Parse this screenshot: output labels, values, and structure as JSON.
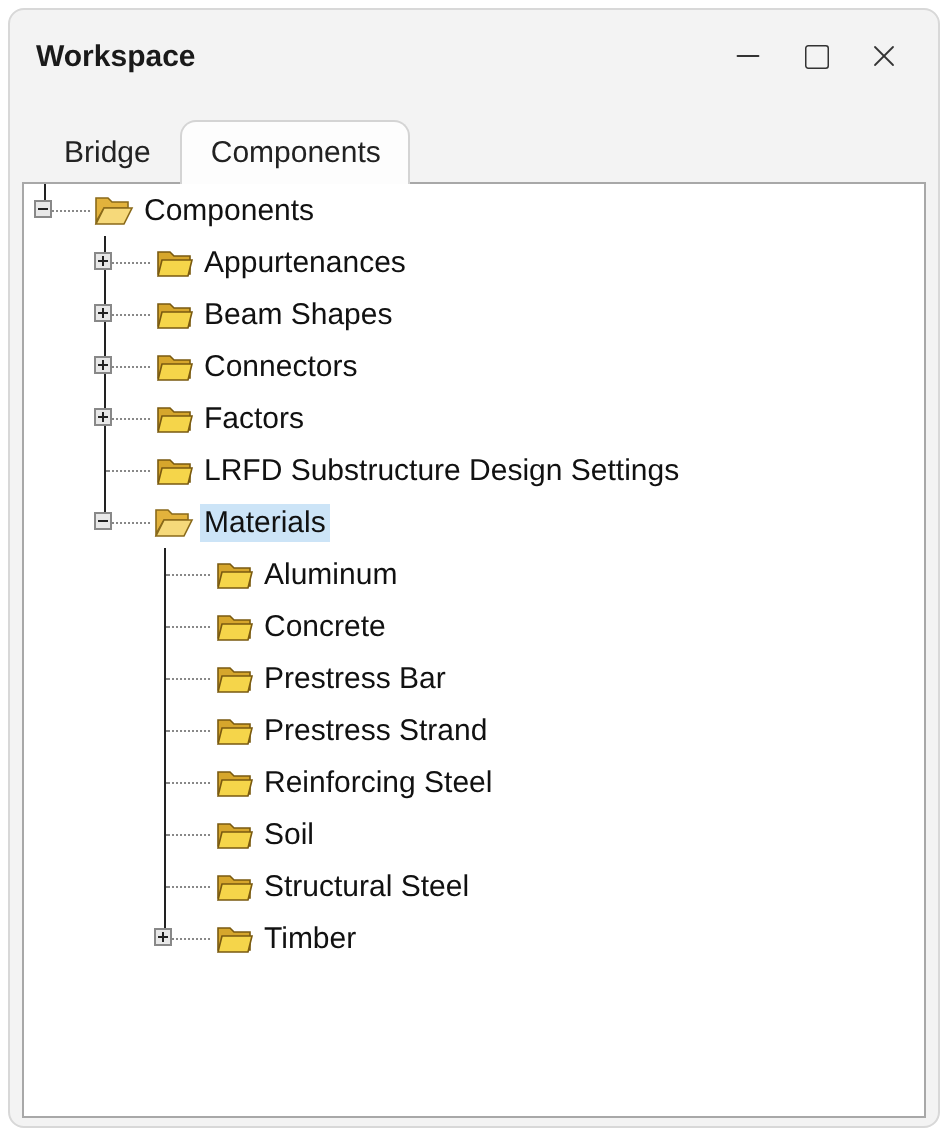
{
  "window": {
    "title": "Workspace"
  },
  "window_controls": [
    {
      "kind": "minimize"
    },
    {
      "kind": "maximize"
    },
    {
      "kind": "close"
    }
  ],
  "tabs": [
    {
      "label": "Bridge",
      "selected": false
    },
    {
      "label": "Components",
      "selected": true
    }
  ],
  "tree": [
    {
      "label": "Components",
      "expanded": true,
      "selected": false,
      "children": [
        {
          "label": "Appurtenances",
          "expanded": false,
          "selected": false
        },
        {
          "label": "Beam Shapes",
          "expanded": false,
          "selected": false
        },
        {
          "label": "Connectors",
          "expanded": false,
          "selected": false
        },
        {
          "label": "Factors",
          "expanded": false,
          "selected": false
        },
        {
          "label": "LRFD Substructure Design Settings",
          "selected": false
        },
        {
          "label": "Materials",
          "expanded": true,
          "selected": true,
          "children": [
            {
              "label": "Aluminum",
              "selected": false
            },
            {
              "label": "Concrete",
              "selected": false
            },
            {
              "label": "Prestress Bar",
              "selected": false
            },
            {
              "label": "Prestress Strand",
              "selected": false
            },
            {
              "label": "Reinforcing Steel",
              "selected": false
            },
            {
              "label": "Soil",
              "selected": false
            },
            {
              "label": "Structural Steel",
              "selected": false
            },
            {
              "label": "Timber",
              "expanded": false,
              "selected": false
            }
          ]
        }
      ]
    }
  ]
}
